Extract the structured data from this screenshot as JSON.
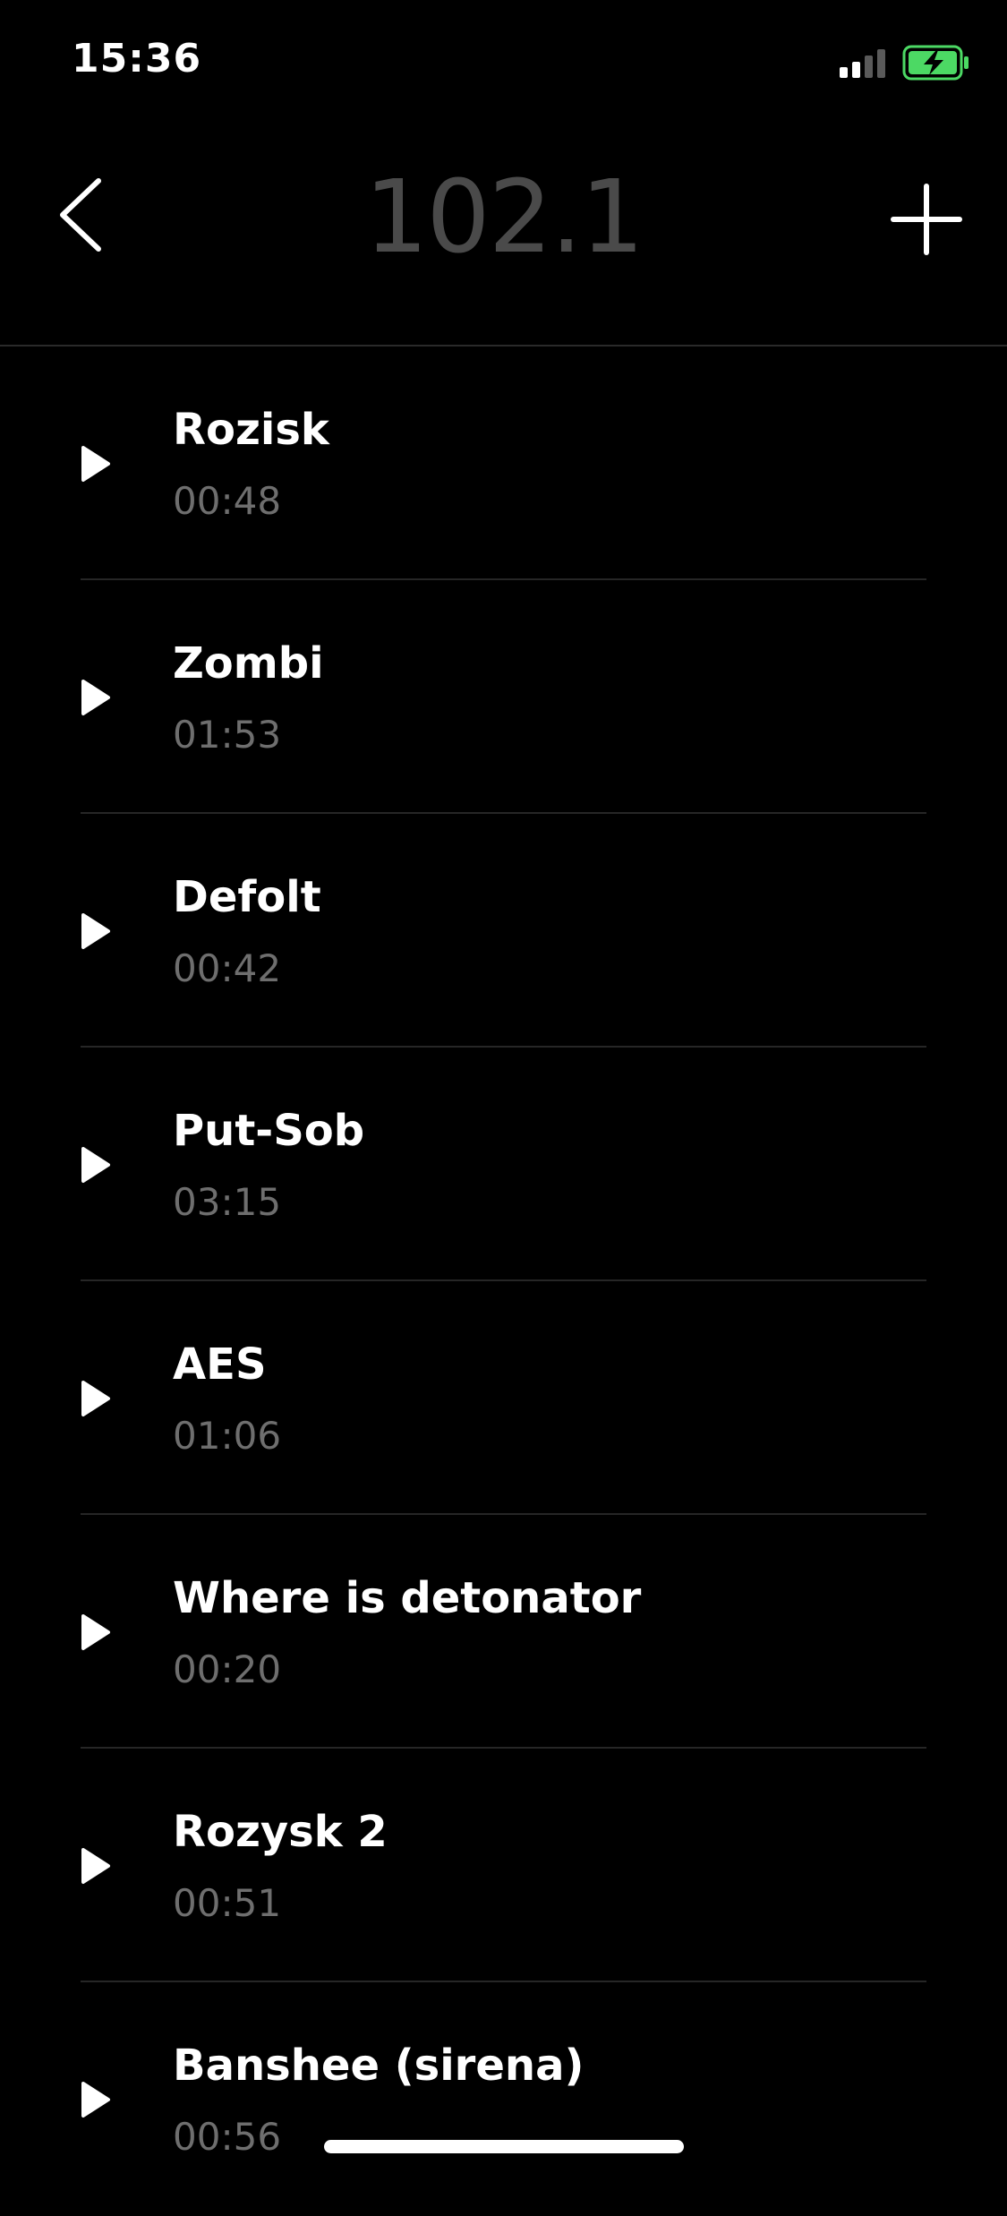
{
  "status_bar": {
    "time": "15:36",
    "signal_icon": "cellular-signal-icon",
    "battery_icon": "battery-charging-icon",
    "battery_color": "#4cd964"
  },
  "header": {
    "title": "102.1",
    "back_icon": "chevron-left-icon",
    "add_icon": "plus-icon"
  },
  "recordings": [
    {
      "title": "Rozisk",
      "duration": "00:48"
    },
    {
      "title": "Zombi",
      "duration": "01:53"
    },
    {
      "title": "Defolt",
      "duration": "00:42"
    },
    {
      "title": "Put-Sob",
      "duration": "03:15"
    },
    {
      "title": "AES",
      "duration": "01:06"
    },
    {
      "title": "Where is detonator",
      "duration": "00:20"
    },
    {
      "title": "Rozysk 2",
      "duration": "00:51"
    },
    {
      "title": "Banshee (sirena)",
      "duration": "00:56"
    }
  ],
  "colors": {
    "background": "#000000",
    "title_dim": "#4a4a4a",
    "secondary_text": "#6e6e6e",
    "divider": "#262626"
  }
}
